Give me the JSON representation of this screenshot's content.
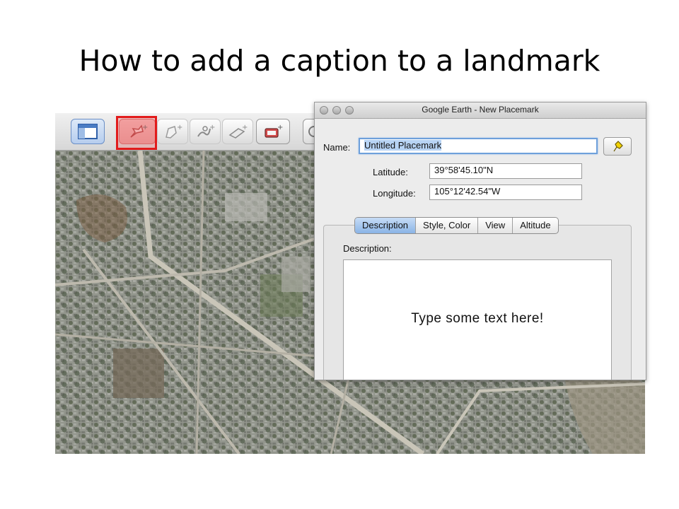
{
  "slide": {
    "title": "How to add a caption to a landmark"
  },
  "toolbar": {
    "buttons": [
      {
        "name": "sidebar-toggle-button",
        "icon": "sidebar-icon"
      },
      {
        "name": "add-placemark-button",
        "icon": "placemark-pushpin-icon",
        "highlighted": true
      },
      {
        "name": "add-polygon-button",
        "icon": "polygon-icon"
      },
      {
        "name": "add-path-button",
        "icon": "path-icon"
      },
      {
        "name": "add-image-overlay-button",
        "icon": "image-overlay-icon"
      },
      {
        "name": "record-tour-button",
        "icon": "record-tour-icon"
      }
    ]
  },
  "dialog": {
    "title": "Google Earth - New Placemark",
    "name_label": "Name:",
    "name_value": "Untitled Placemark",
    "latitude_label": "Latitude:",
    "latitude_value": "39°58'45.10\"N",
    "longitude_label": "Longitude:",
    "longitude_value": "105°12'42.54\"W",
    "tabs": [
      {
        "label": "Description",
        "active": true
      },
      {
        "label": "Style, Color",
        "active": false
      },
      {
        "label": "View",
        "active": false
      },
      {
        "label": "Altitude",
        "active": false
      }
    ],
    "description_label": "Description:",
    "description_text": "Type some text here!"
  },
  "colors": {
    "highlight": "#e21b1b",
    "active_tab": "#8ab4e6",
    "name_focus": "#6ea0db"
  }
}
